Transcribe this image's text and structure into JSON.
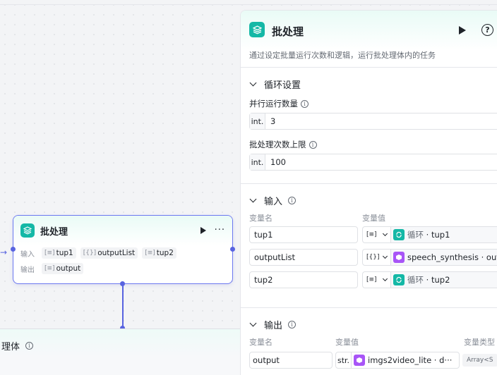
{
  "node": {
    "title": "批处理",
    "more": "···",
    "input_label": "输入",
    "output_label": "输出",
    "inputs": [
      {
        "type_glyph": "[≡]",
        "name": "tup1"
      },
      {
        "type_glyph": "[{}]",
        "name": "outputList"
      },
      {
        "type_glyph": "[≡]",
        "name": "tup2"
      }
    ],
    "outputs": [
      {
        "type_glyph": "[≡]",
        "name": "output"
      }
    ]
  },
  "bottom_panel": {
    "title": "理体"
  },
  "panel": {
    "title": "批处理",
    "description": "通过设定批量运行次数和逻辑，运行批处理体内的任务",
    "loop_section": {
      "title": "循环设置",
      "parallel_label": "并行运行数量",
      "parallel_prefix": "int.",
      "parallel_value": "3",
      "limit_label": "批处理次数上限",
      "limit_prefix": "int.",
      "limit_value": "100"
    },
    "input_section": {
      "title": "输入",
      "col_name": "变量名",
      "col_value": "变量值",
      "rows": [
        {
          "name": "tup1",
          "type_glyph": "[≡]",
          "ref_source": "循环",
          "ref_var": "tup1",
          "badge": "teal"
        },
        {
          "name": "outputList",
          "type_glyph": "[{}]",
          "ref_source": "speech_synthesis",
          "ref_var": "out",
          "badge": "purple"
        },
        {
          "name": "tup2",
          "type_glyph": "[≡]",
          "ref_source": "循环",
          "ref_var": "tup2",
          "badge": "teal"
        }
      ]
    },
    "output_section": {
      "title": "输出",
      "col_name": "变量名",
      "col_value": "变量值",
      "col_type": "变量类型",
      "rows": [
        {
          "name": "output",
          "prefix": "str.",
          "ref_source": "imgs2video_lite",
          "ref_var": "d···",
          "type": "Array<S"
        }
      ]
    }
  },
  "colors": {
    "accent": "#5863e0",
    "teal": "#14b8a6",
    "purple": "#a855f7"
  }
}
